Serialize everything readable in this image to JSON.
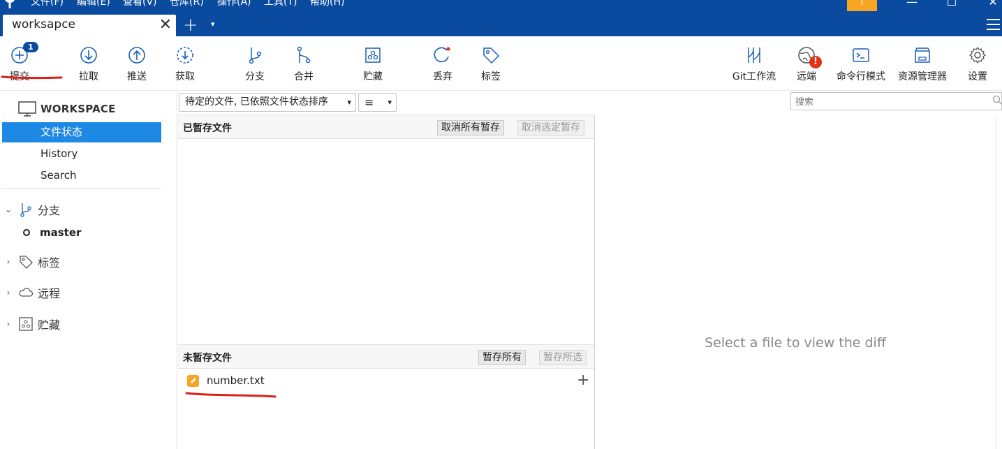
{
  "menu": {
    "items": [
      "文件(F)",
      "编辑(E)",
      "查看(V)",
      "仓库(R)",
      "操作(A)",
      "工具(T)",
      "帮助(H)"
    ]
  },
  "window": {
    "minimize": "—",
    "maximize": "☐",
    "close": "✕",
    "update_arrow": "↑"
  },
  "tabs": [
    {
      "label": "worksapce",
      "close": "✕"
    }
  ],
  "tab_controls": {
    "add": "+",
    "more": "▾"
  },
  "toolbar": {
    "commit": "提交",
    "commit_badge": "1",
    "pull": "拉取",
    "push": "推送",
    "fetch": "获取",
    "branch": "分支",
    "merge": "合并",
    "stash": "贮藏",
    "discard": "丢弃",
    "tag": "标签",
    "git_flow": "Git工作流",
    "remote": "远端",
    "remote_alert": "!",
    "terminal": "命令行模式",
    "explorer": "资源管理器",
    "settings": "设置"
  },
  "sidebar": {
    "workspace_title": "WORKSPACE",
    "items": [
      {
        "label": "文件状态",
        "active": true
      },
      {
        "label": "History",
        "active": false
      },
      {
        "label": "Search",
        "active": false
      }
    ],
    "groups": {
      "branches": "分支",
      "tags": "标签",
      "remotes": "远程",
      "stashes": "贮藏"
    },
    "current_branch": "master"
  },
  "filter": {
    "sort_mode": "待定的文件, 已依照文件状态排序",
    "view_mode_icon": "list-icon",
    "search_placeholder": "搜索"
  },
  "staged": {
    "title": "已暂存文件",
    "unstage_all": "取消所有暂存",
    "unstage_selected": "取消选定暂存"
  },
  "unstaged": {
    "title": "未暂存文件",
    "stage_all": "暂存所有",
    "stage_selected": "暂存所选",
    "files": [
      {
        "name": "number.txt",
        "status": "modified"
      }
    ]
  },
  "diff": {
    "placeholder": "Select a file to view the diff"
  },
  "colors": {
    "titlebar": "#0a4b9f",
    "accent": "#1e88e5",
    "update": "#f6a623",
    "alert": "#e0341a",
    "annotation": "#d9201a"
  }
}
